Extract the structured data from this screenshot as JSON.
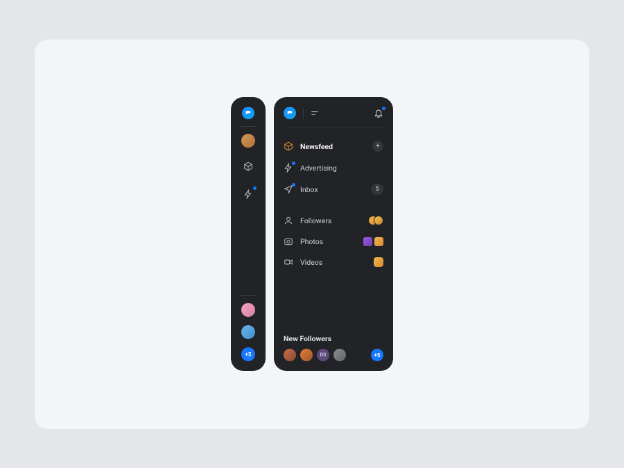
{
  "rail": {
    "more_count": "+5"
  },
  "header": {
    "has_notification": true
  },
  "nav": {
    "newsfeed": {
      "label": "Newsfeed"
    },
    "advertising": {
      "label": "Advertising"
    },
    "inbox": {
      "label": "Inbox",
      "count": "5"
    },
    "followers": {
      "label": "Followers"
    },
    "photos": {
      "label": "Photos"
    },
    "videos": {
      "label": "Videos"
    }
  },
  "new_followers": {
    "title": "New Followers",
    "initials": "DS",
    "more_count": "+5"
  }
}
